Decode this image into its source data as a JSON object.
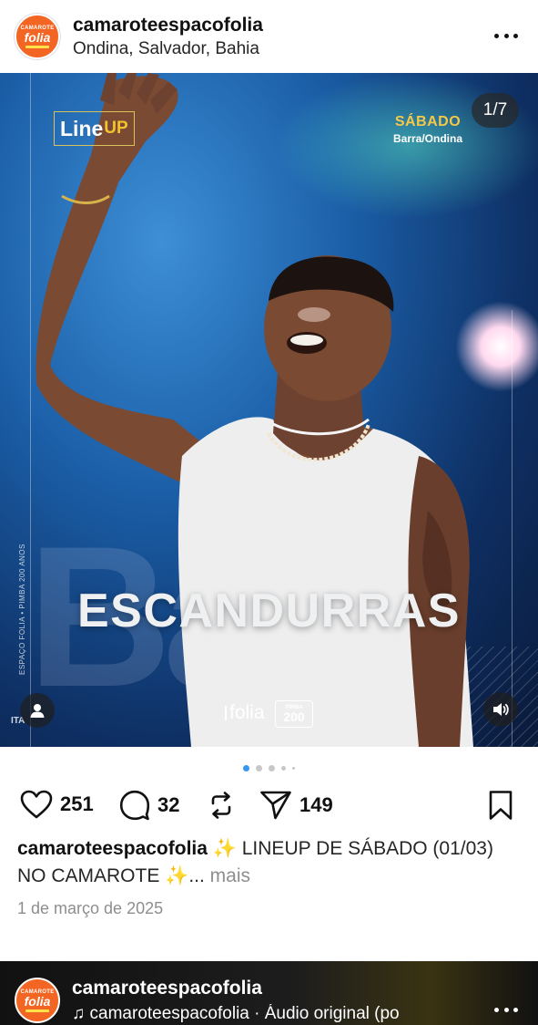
{
  "post": {
    "avatar": {
      "top": "CAMAROTE",
      "main": "folia"
    },
    "username": "camaroteespacofolia",
    "location": "Ondina, Salvador, Bahia",
    "more_icon": "more-horizontal-icon"
  },
  "media": {
    "lineup_main": "Line",
    "lineup_up": "UP",
    "day_title": "SÁBADO",
    "day_sub": "Barra/Ondina",
    "counter": "1/7",
    "artist": "ESCANDURRAS",
    "side_text": "ESPAÇO FOLIA • PIMBA 200 ANOS",
    "side_text_bottom": "ITA",
    "brand_folia": "folia",
    "brand_pimba_top": "PIMBA",
    "brand_pimba_num": "200",
    "user_tag_icon": "user-icon",
    "sound_icon": "speaker-icon",
    "colors": {
      "accent_gold": "#f2c230",
      "day_gold": "#f6c84a"
    }
  },
  "pagination": {
    "total_visible": 5,
    "active_index": 0
  },
  "actions": {
    "likes": "251",
    "comments": "32",
    "shares": "149",
    "icons": [
      "heart-icon",
      "comment-icon",
      "repost-icon",
      "send-icon",
      "bookmark-icon"
    ]
  },
  "caption": {
    "user": "camaroteespacofolia",
    "text": " ✨ LINEUP DE SÁBADO (01/03) NO CAMAROTE ✨...",
    "more": " mais"
  },
  "date": "1 de março de 2025",
  "next_post": {
    "avatar": {
      "top": "CAMAROTE",
      "main": "folia"
    },
    "username": "camaroteespacofolia",
    "audio": "♫ camaroteespacofolia · Áudio original (po"
  }
}
